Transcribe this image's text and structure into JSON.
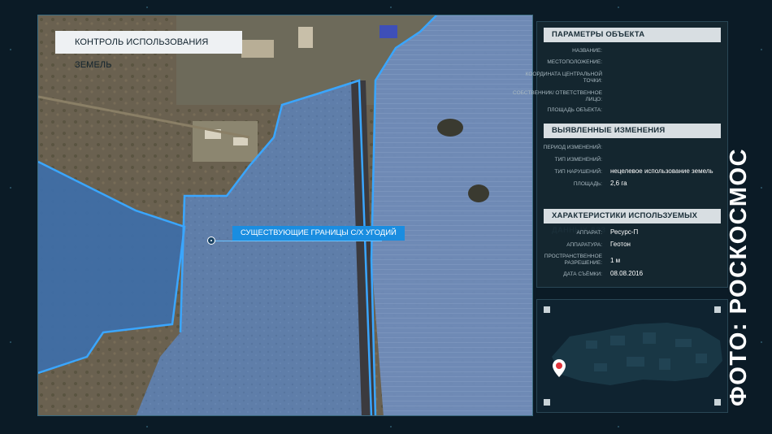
{
  "map": {
    "title": "КОНТРОЛЬ ИСПОЛЬЗОВАНИЯ ЗЕМЕЛЬ",
    "callout_label": "СУЩЕСТВУЮЩИЕ ГРАНИЦЫ С/Х УГОДИЙ"
  },
  "object_params": {
    "heading": "ПАРАМЕТРЫ ОБЪЕКТА",
    "rows": [
      {
        "label": "НАЗВАНИЕ:",
        "value": ""
      },
      {
        "label": "МЕСТОПОЛОЖЕНИЕ:",
        "value": ""
      },
      {
        "label": "КООРДИНАТА ЦЕНТРАЛЬНОЙ ТОЧКИ:",
        "value": ""
      },
      {
        "label": "СОБСТВЕННИК/ ОТВЕТСТВЕННОЕ ЛИЦО:",
        "value": ""
      },
      {
        "label": "ПЛОЩАДЬ ОБЪЕКТА:",
        "value": ""
      }
    ]
  },
  "changes": {
    "heading": "ВЫЯВЛЕННЫЕ ИЗМЕНЕНИЯ",
    "rows": [
      {
        "label": "ПЕРИОД ИЗМЕНЕНИЙ:",
        "value": ""
      },
      {
        "label": "ТИП ИЗМЕНЕНИЙ:",
        "value": ""
      },
      {
        "label": "ТИП НАРУШЕНИЙ:",
        "value": "нецелевое использование земель"
      },
      {
        "label": "ПЛОЩАДЬ:",
        "value": "2,6 га"
      }
    ]
  },
  "rs_data": {
    "heading": "ХАРАКТЕРИСТИКИ ИСПОЛЬЗУЕМЫХ ДАННЫХ ДЗЗ",
    "rows": [
      {
        "label": "АППАРАТ:",
        "value": "Ресурс-П"
      },
      {
        "label": "АППАРАТУРА:",
        "value": "Геотон"
      },
      {
        "label": "ПРОСТРАНСТВЕННОЕ РАЗРЕШЕНИЕ:",
        "value": "1 м"
      },
      {
        "label": "ДАТА СЪЁМКИ:",
        "value": "08.08.2016"
      }
    ]
  },
  "watermark": "ФОТО: РОСКОСМОС",
  "icons": {
    "location_pin": "map-pin-icon",
    "callout_marker": "target-dot-icon"
  },
  "colors": {
    "accent": "#1a8de0",
    "boundary": "#3aa6ff",
    "pin": "#e0333a"
  }
}
